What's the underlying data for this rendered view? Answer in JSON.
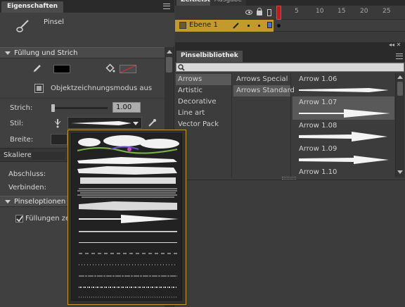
{
  "properties_panel": {
    "tab_title": "Eigenschaften",
    "tool_name": "Pinsel",
    "section_fill_stroke": "Füllung und Strich",
    "object_drawing_mode": "Objektzeichnungsmodus aus",
    "stroke_label": "Strich:",
    "stroke_value": "1.00",
    "stroke_slider_fraction": 0.02,
    "style_label": "Stil:",
    "width_label": "Breite:",
    "scale_label": "Skalieren:",
    "cap_label": "Abschluss:",
    "join_label": "Verbinden:",
    "section_brush_options": "Pinseloptionen",
    "fill_checkbox_label": "Füllungen zeichnen",
    "fill_checkbox_checked": true,
    "stroke_color": "#000000",
    "fill_color": "none"
  },
  "timeline": {
    "tab_titles": [
      "Zeitleiste",
      "Ausgabe"
    ],
    "layer_name": "Ebene 1",
    "frame_numbers": [
      "1",
      "5",
      "10",
      "15",
      "20",
      "25"
    ],
    "current_frame": 1
  },
  "brush_library": {
    "title": "Pinselbibliothek",
    "search_placeholder": "",
    "categories": [
      "Arrows",
      "Artistic",
      "Decorative",
      "Line art",
      "Vector Pack"
    ],
    "selected_category": "Arrows",
    "subcategories": [
      "Arrows Special",
      "Arrows Standard"
    ],
    "selected_subcategory": "Arrows Standard",
    "brushes": [
      {
        "name": "Arrow 1.06"
      },
      {
        "name": "Arrow 1.07"
      },
      {
        "name": "Arrow 1.08"
      },
      {
        "name": "Arrow 1.09"
      },
      {
        "name": "Arrow 1.10"
      }
    ],
    "selected_brush": "Arrow 1.07"
  },
  "colors": {
    "accent": "#c49a2c",
    "selection": "#595959",
    "panel": "#3c3c3c",
    "playhead": "#c02020"
  }
}
